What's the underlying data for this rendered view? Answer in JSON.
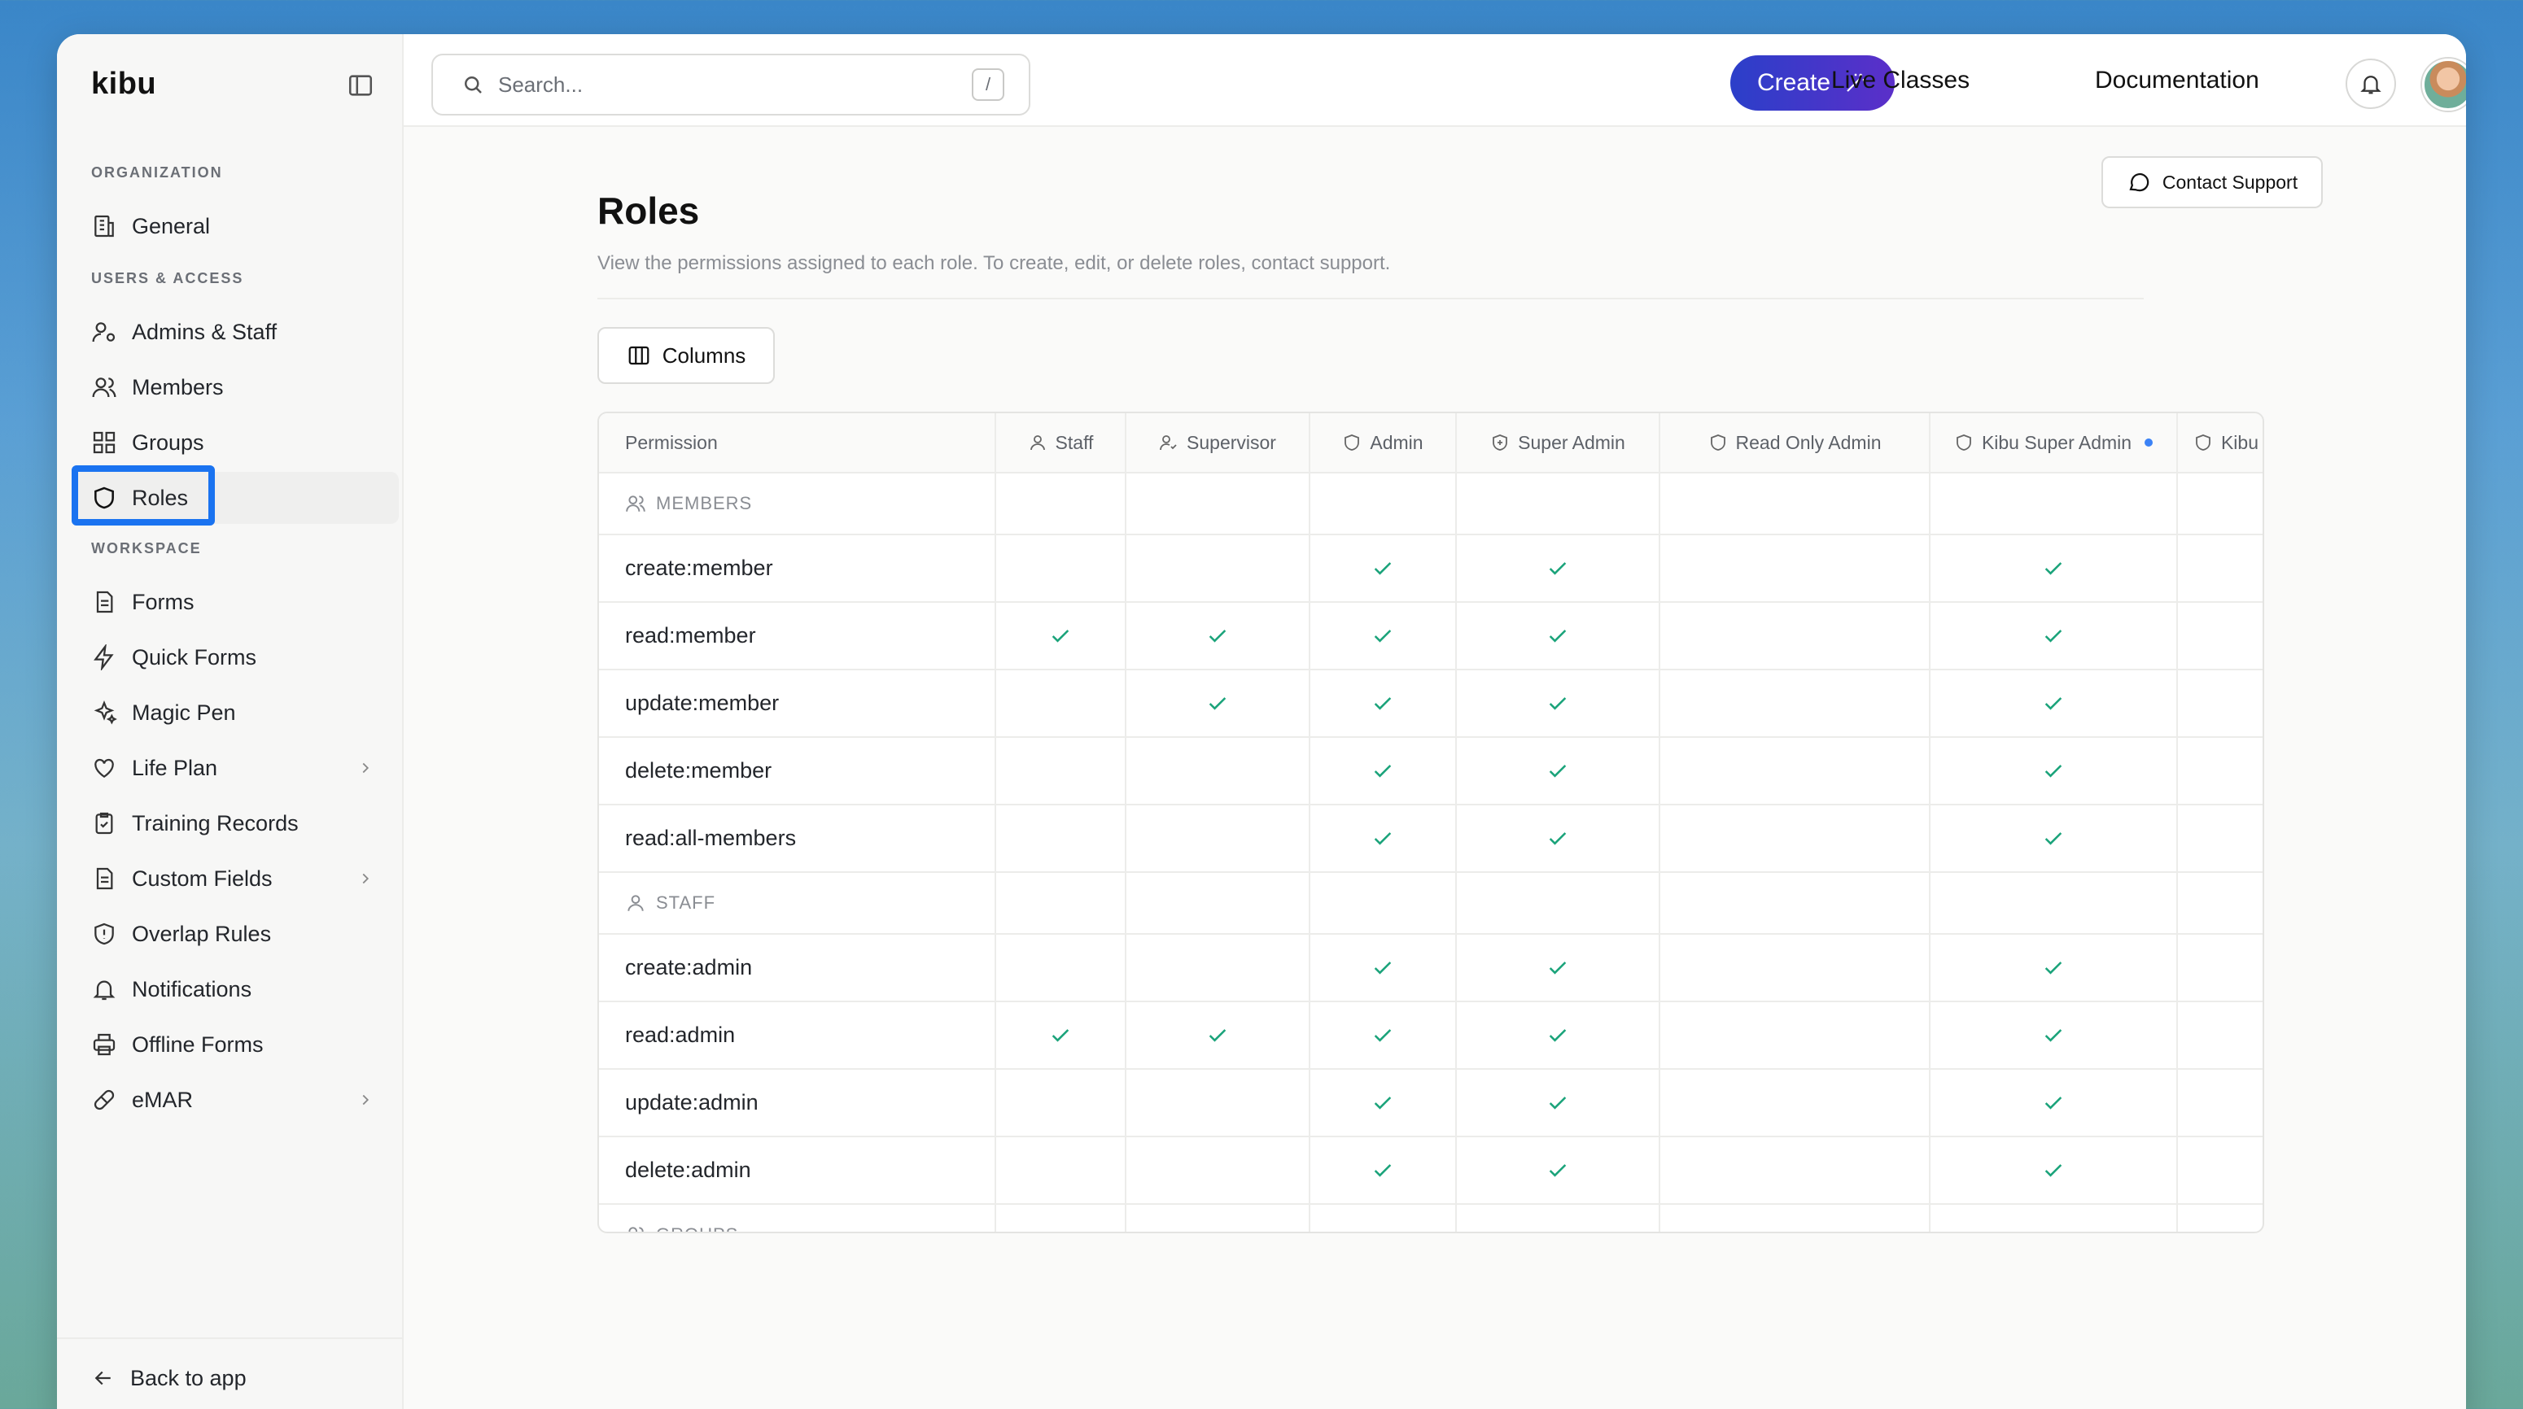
{
  "app": {
    "brand": "kibu"
  },
  "sidebar": {
    "sections": [
      {
        "label": "ORGANIZATION"
      },
      {
        "label": "USERS & ACCESS"
      },
      {
        "label": "WORKSPACE"
      }
    ],
    "items": [
      {
        "label": "General",
        "icon": "building-icon"
      },
      {
        "label": "Admins & Staff",
        "icon": "user-gear-icon"
      },
      {
        "label": "Members",
        "icon": "users-icon"
      },
      {
        "label": "Groups",
        "icon": "grid-icon"
      },
      {
        "label": "Roles",
        "icon": "shield-icon",
        "active": true
      },
      {
        "label": "Forms",
        "icon": "document-icon"
      },
      {
        "label": "Quick Forms",
        "icon": "lightning-icon"
      },
      {
        "label": "Magic Pen",
        "icon": "sparkles-icon"
      },
      {
        "label": "Life Plan",
        "icon": "heart-icon",
        "expandable": true
      },
      {
        "label": "Training Records",
        "icon": "clipboard-check-icon"
      },
      {
        "label": "Custom Fields",
        "icon": "document-icon",
        "expandable": true
      },
      {
        "label": "Overlap Rules",
        "icon": "shield-alert-icon"
      },
      {
        "label": "Notifications",
        "icon": "bell-icon"
      },
      {
        "label": "Offline Forms",
        "icon": "printer-icon"
      },
      {
        "label": "eMAR",
        "icon": "pill-icon",
        "expandable": true
      }
    ],
    "footer": {
      "back_label": "Back to app"
    }
  },
  "topbar": {
    "search_placeholder": "Search...",
    "search_shortcut": "/",
    "create_label": "Create",
    "live_classes_label": "Live Classes",
    "documentation_label": "Documentation"
  },
  "page": {
    "title": "Roles",
    "description": "View the permissions assigned to each role. To create, edit, or delete roles, contact support.",
    "contact_support_label": "Contact Support",
    "columns_label": "Columns"
  },
  "table": {
    "permission_header": "Permission",
    "roles": [
      {
        "name": "Staff",
        "icon": "user-icon"
      },
      {
        "name": "Supervisor",
        "icon": "user-check-icon"
      },
      {
        "name": "Admin",
        "icon": "shield-icon"
      },
      {
        "name": "Super Admin",
        "icon": "shield-plus-icon"
      },
      {
        "name": "Read Only Admin",
        "icon": "shield-icon"
      },
      {
        "name": "Kibu Super Admin",
        "icon": "shield-icon",
        "indicator": true
      },
      {
        "name": "Kibu",
        "icon": "shield-icon"
      }
    ],
    "rows": [
      {
        "type": "group",
        "label": "MEMBERS",
        "icon": "users-icon"
      },
      {
        "type": "perm",
        "label": "create:member",
        "grants": [
          false,
          false,
          true,
          true,
          false,
          true,
          false
        ]
      },
      {
        "type": "perm",
        "label": "read:member",
        "grants": [
          true,
          true,
          true,
          true,
          false,
          true,
          false
        ]
      },
      {
        "type": "perm",
        "label": "update:member",
        "grants": [
          false,
          true,
          true,
          true,
          false,
          true,
          false
        ]
      },
      {
        "type": "perm",
        "label": "delete:member",
        "grants": [
          false,
          false,
          true,
          true,
          false,
          true,
          false
        ]
      },
      {
        "type": "perm",
        "label": "read:all-members",
        "grants": [
          false,
          false,
          true,
          true,
          false,
          true,
          false
        ]
      },
      {
        "type": "group",
        "label": "STAFF",
        "icon": "user-icon"
      },
      {
        "type": "perm",
        "label": "create:admin",
        "grants": [
          false,
          false,
          true,
          true,
          false,
          true,
          false
        ]
      },
      {
        "type": "perm",
        "label": "read:admin",
        "grants": [
          true,
          true,
          true,
          true,
          false,
          true,
          false
        ]
      },
      {
        "type": "perm",
        "label": "update:admin",
        "grants": [
          false,
          false,
          true,
          true,
          false,
          true,
          false
        ]
      },
      {
        "type": "perm",
        "label": "delete:admin",
        "grants": [
          false,
          false,
          true,
          true,
          false,
          true,
          false
        ]
      },
      {
        "type": "group",
        "label": "GROUPS",
        "icon": "users-icon"
      }
    ]
  },
  "colors": {
    "accent": "#1a73f0",
    "check": "#1aa37a",
    "create_gradient_start": "#2b3fc9",
    "create_gradient_end": "#5b2fc9"
  }
}
